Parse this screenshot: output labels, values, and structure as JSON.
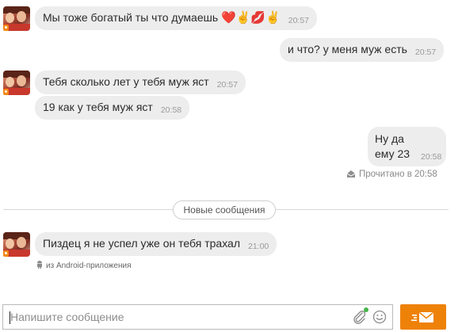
{
  "messages": [
    {
      "text": "Мы тоже богатый ты что думаешь",
      "emojis": "❤️✌️💋✌️",
      "time": "20:57"
    },
    {
      "text": "и что? у меня муж есть",
      "time": "20:57"
    },
    {
      "text": "Тебя сколько лет у тебя муж яст",
      "time": "20:57"
    },
    {
      "text": "19 как у тебя муж яст",
      "time": "20:58"
    },
    {
      "line1": "Ну да",
      "line2": "ему 23",
      "time": "20:58"
    },
    {
      "text": "Пиздец я не успел уже он тебя трахал",
      "time": "21:00"
    }
  ],
  "read_status": "Прочитано в 20:58",
  "new_messages_label": "Новые сообщения",
  "source_label": "из Android-приложения",
  "composer": {
    "placeholder": "Напишите сообщение"
  },
  "icons": {
    "read": "envelope-open-icon",
    "android": "android-icon",
    "attach": "paperclip-icon",
    "emoji": "smiley-icon",
    "send": "envelope-icon"
  },
  "colors": {
    "accent": "#ee8208",
    "bubble": "#ededed",
    "online_dot": "#44b549"
  }
}
